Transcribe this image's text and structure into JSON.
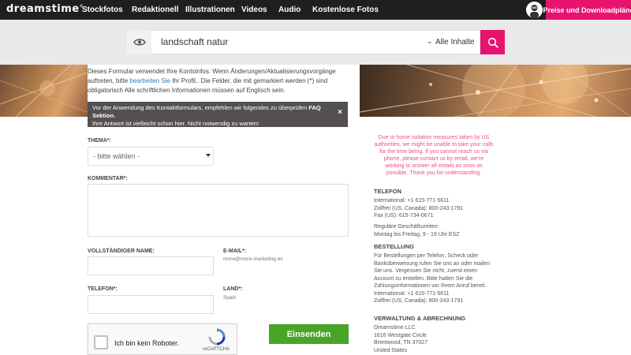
{
  "nav": {
    "logo": "dreamstime",
    "logo_mark": "®",
    "items": [
      "Stockfotos",
      "Redaktionell",
      "Illustrationen",
      "Videos",
      "Audio",
      "Kostenlose Fotos"
    ],
    "plans_label": "Preise und Downloadpläne"
  },
  "search": {
    "query": "landschaft natur",
    "scope": "Alle Inhalte"
  },
  "intro": {
    "part1": "Dieses Formular verwendet Ihre Kontoinfos. Wenn Änderungen/Aktualisierungsvorgänge auftreten, bitte ",
    "link": "bearbeiten Sie",
    "part2": " Ihr Profil.. Die Felder, die mit gemarkiert werden (*) sind obligatorisch Alle schriftlichen Informationen müssen auf Englisch sein."
  },
  "notice": {
    "part1": "Vor der Anwendung des Kontaktformulars, empfehlen wir folgendes zu überprüfen ",
    "faq": "FAQ Sektion.",
    "part2": "Ihre Antwort ist vielleicht schon hier. Nicht notwendig zu warten!",
    "close": "×"
  },
  "form": {
    "topic_label": "THEMA*:",
    "topic_value": "- bitte wählen -",
    "comment_label": "KOMMENTAR*:",
    "name_label": "VOLLSTÄNDIGER NAME:",
    "email_label": "E-MAIL*:",
    "email_value": "more@more-marketing.ex",
    "phone_label": "TELEFON*:",
    "country_label": "LAND*:",
    "country_value": "Spain",
    "captcha_text": "Ich bin kein Roboter.",
    "captcha_brand": "reCAPTCHA",
    "submit_label": "Einsenden"
  },
  "contact": {
    "notice": "Due to home isolation measures taken by US authorities, we might be unable to take your calls for the time being. If you cannot reach us via phone, please contact us by email, we're working to answer all emails as soon as possible. Thank you for understanding.",
    "phone_heading": "TELEFON",
    "phone_lines": "International: +1 615-771-5611\nZollfrei (US, Canada): 800-243-1791\nFax (US): 615-734-0671",
    "hours_lines": "Reguläre Geschäftszeiten:\nMontag bis Freitag, 9 - 19 Uhr ESZ",
    "order_heading": "BESTELLUNG",
    "order_lines": "Für Bestellungen per Telefon, Scheck oder Banküberweisung rufen Sie uns an oder mailen Sie uns. Vergessen Sie nicht, zuerst einen Account zu erstellen. Bitte halten Sie die Zahlungsinformationen vor Ihrem Anruf bereit.\nInternational: +1 615-771-5611\nZollfrei (US, Canada): 800-243-1791",
    "admin_heading": "VERWALTUNG & ABRECHNUNG",
    "admin_lines": "Dreamstime LLC\n1616 Westgate Circle\nBrentwood, TN 37027\nUnited States"
  },
  "colors": {
    "brand_pink": "#e8136f",
    "submit_green": "#4aa428",
    "notice_pink": "#e84f8f"
  }
}
